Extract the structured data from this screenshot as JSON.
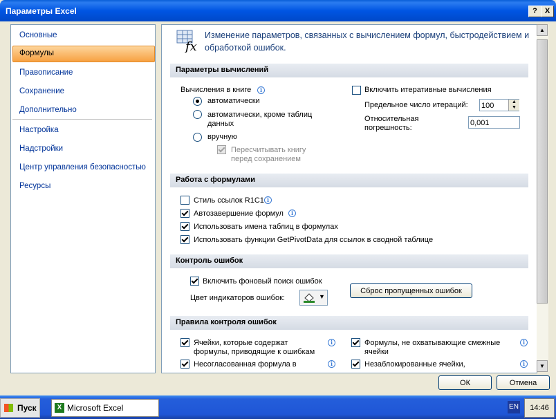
{
  "window": {
    "title": "Параметры Excel",
    "help": "?",
    "close": "X"
  },
  "nav": {
    "items": [
      "Основные",
      "Формулы",
      "Правописание",
      "Сохранение",
      "Дополнительно",
      "Настройка",
      "Надстройки",
      "Центр управления безопасностью",
      "Ресурсы"
    ]
  },
  "header": {
    "line1": "Изменение параметров, связанных с вычислением формул, быстродействием и",
    "line2": "обработкой ошибок."
  },
  "calc": {
    "title": "Параметры вычислений",
    "book_label": "Вычисления в книге",
    "auto": "автоматически",
    "auto_except_1": "автоматически, кроме таблиц",
    "auto_except_2": "данных",
    "manual": "вручную",
    "recalc_1": "Пересчитывать книгу",
    "recalc_2": "перед сохранением",
    "iter": "Включить итеративные вычисления",
    "max_iter_label": "Предельное число итераций:",
    "max_iter_value": "100",
    "rel_1": "Относительная",
    "rel_2": "погрешность:",
    "rel_value": "0,001"
  },
  "formulas": {
    "title": "Работа с формулами",
    "r1c1": "Стиль ссылок R1C1",
    "autocomplete": "Автозавершение формул",
    "table_names": "Использовать имена таблиц в формулах",
    "getpivot": "Использовать функции GetPivotData для ссылок в сводной таблице"
  },
  "errors": {
    "title": "Контроль ошибок",
    "bg_check": "Включить фоновый поиск ошибок",
    "color_label": "Цвет индикаторов ошибок:",
    "reset": "Сброс пропущенных ошибок"
  },
  "rules": {
    "title": "Правила контроля ошибок",
    "r1_1": "Ячейки, которые содержат",
    "r1_2": "формулы, приводящие к ошибкам",
    "r2_1": "Формулы, не охватывающие смежные",
    "r2_2": "ячейки",
    "r3_1": "Несогласованная формула в",
    "r4_1": "Незаблокированные ячейки,"
  },
  "footer": {
    "ok": "ОК",
    "cancel": "Отмена"
  },
  "taskbar": {
    "start": "Пуск",
    "app": "Microsoft Excel",
    "lang": "EN",
    "time": "14:46"
  }
}
